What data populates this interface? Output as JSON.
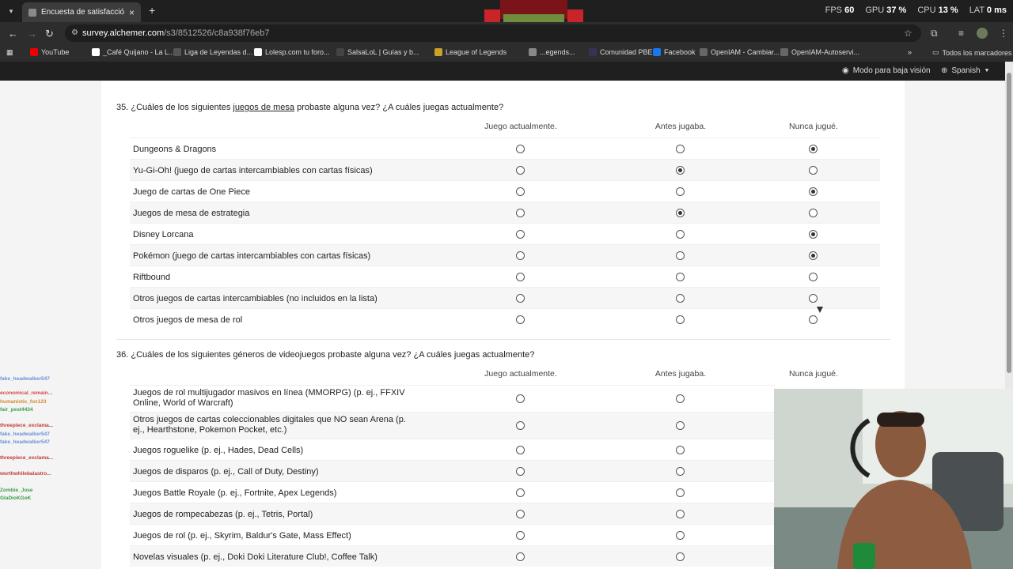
{
  "browser": {
    "tab_title": "Encuesta de satisfacción sobre l",
    "url_host": "survey.alchemer.com",
    "url_path": "/s3/8512526/c8a938f76eb7",
    "stats": [
      {
        "label": "FPS",
        "value": "60"
      },
      {
        "label": "GPU",
        "value": "37 %"
      },
      {
        "label": "CPU",
        "value": "13 %"
      },
      {
        "label": "LAT",
        "value": "0 ms"
      }
    ],
    "bookmarks": [
      "YouTube",
      "_Café Quijano - La L...",
      "Liga de Leyendas d...",
      "Lolesp.com tu foro...",
      "SalsaLoL | Guías y b...",
      "League of Legends",
      "...egends...",
      "Comunidad PBE",
      "Facebook",
      "OpenIAM - Cambiar...",
      "OpenIAM-Autoservi..."
    ],
    "all_bookmarks": "Todos los marcadores"
  },
  "survey_bar": {
    "low_vision": "Modo para baja visión",
    "language": "Spanish"
  },
  "columns": [
    "Juego actualmente.",
    "Antes jugaba.",
    "Nunca jugué."
  ],
  "q35": {
    "number": "35.",
    "text_before": "¿Cuáles de los siguientes ",
    "text_link": "juegos de mesa",
    "text_after": " probaste alguna vez? ¿A cuáles juegas actualmente?",
    "rows": [
      {
        "label": "Dungeons & Dragons",
        "selected": 2
      },
      {
        "label": "Yu-Gi-Oh! (juego de cartas intercambiables con cartas físicas)",
        "selected": 1
      },
      {
        "label": "Juego de cartas de One Piece",
        "selected": 2
      },
      {
        "label": "Juegos de mesa de estrategia",
        "selected": 1
      },
      {
        "label": "Disney Lorcana",
        "selected": 2
      },
      {
        "label": "Pokémon (juego de cartas intercambiables con cartas físicas)",
        "selected": 2
      },
      {
        "label": "Riftbound",
        "selected": -1
      },
      {
        "label": "Otros juegos de cartas intercambiables (no incluidos en la lista)",
        "selected": -1
      },
      {
        "label": "Otros juegos de mesa de rol",
        "selected": -1
      }
    ]
  },
  "q36": {
    "number": "36.",
    "text": "¿Cuáles de los siguientes géneros de videojuegos probaste alguna vez? ¿A cuáles juegas actualmente?",
    "rows": [
      {
        "label": "Juegos de rol multijugador masivos en línea (MMORPG) (p. ej., FFXIV Online, World of Warcraft)",
        "selected": -1
      },
      {
        "label": "Otros juegos de cartas coleccionables digitales que NO sean Arena (p. ej., Hearthstone, Pokemon Pocket, etc.)",
        "selected": -1
      },
      {
        "label": "Juegos roguelike (p. ej., Hades, Dead Cells)",
        "selected": -1
      },
      {
        "label": "Juegos de disparos (p. ej., Call of Duty, Destiny)",
        "selected": -1
      },
      {
        "label": "Juegos Battle Royale (p. ej., Fortnite, Apex Legends)",
        "selected": -1
      },
      {
        "label": "Juegos de rompecabezas (p. ej., Tetris, Portal)",
        "selected": -1
      },
      {
        "label": "Juegos de rol (p. ej., Skyrim, Baldur's Gate, Mass Effect)",
        "selected": -1
      },
      {
        "label": "Novelas visuales (p. ej., Doki Doki Literature Club!, Coffee Talk)",
        "selected": -1
      }
    ]
  },
  "chat": [
    {
      "user": "fake_headwalker547",
      "color": "#6b8fd6"
    },
    {
      "user": "economical_remain...",
      "color": "#d04848"
    },
    {
      "user": "humanistic_fox123",
      "color": "#d08a2a"
    },
    {
      "user": "fair_pest4434",
      "color": "#3aa04a"
    },
    {
      "user": "threepiece_exclama...",
      "color": "#c23a3a"
    },
    {
      "user": "fake_headwalker547",
      "color": "#6b8fd6"
    },
    {
      "user": "fake_headwalker547",
      "color": "#6b8fd6"
    },
    {
      "user": "threepiece_exclama...",
      "color": "#c23a3a"
    },
    {
      "user": "worthwhilebalastro...",
      "color": "#c23a3a"
    },
    {
      "user": "Zombie_Jose",
      "color": "#3aa04a"
    },
    {
      "user": "GlaDioKGoK",
      "color": "#3aa04a"
    }
  ]
}
